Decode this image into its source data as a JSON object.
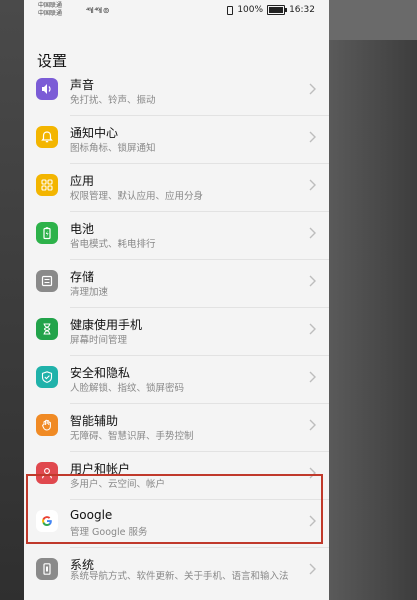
{
  "status": {
    "carrier1": "中国联通",
    "carrier2": "中国联通",
    "signal": "⁴⁶ıl ⁴⁶ıl ⊚",
    "battery_pct": "100%",
    "time": "16:32"
  },
  "page": {
    "title": "设置"
  },
  "items": [
    {
      "title": "声音",
      "sub": "免打扰、铃声、振动",
      "icon": "speaker-icon",
      "color": "#7b5cd6"
    },
    {
      "title": "通知中心",
      "sub": "图标角标、锁屏通知",
      "icon": "bell-icon",
      "color": "#f3b500"
    },
    {
      "title": "应用",
      "sub": "权限管理、默认应用、应用分身",
      "icon": "apps-grid-icon",
      "color": "#f3b500"
    },
    {
      "title": "电池",
      "sub": "省电模式、耗电排行",
      "icon": "battery-icon",
      "color": "#2db24a"
    },
    {
      "title": "存储",
      "sub": "清理加速",
      "icon": "storage-icon",
      "color": "#8a8a8a"
    },
    {
      "title": "健康使用手机",
      "sub": "屏幕时间管理",
      "icon": "hourglass-icon",
      "color": "#22a34a"
    },
    {
      "title": "安全和隐私",
      "sub": "人脸解锁、指纹、锁屏密码",
      "icon": "shield-icon",
      "color": "#20b2aa"
    },
    {
      "title": "智能辅助",
      "sub": "无障碍、智慧识屏、手势控制",
      "icon": "hand-icon",
      "color": "#f08a24"
    },
    {
      "title": "用户和帐户",
      "sub": "多用户、云空间、帐户",
      "icon": "user-icon",
      "color": "#e0484e"
    },
    {
      "title": "Google",
      "sub": "管理 Google 服务",
      "icon": "google-icon",
      "color": "#ffffff"
    },
    {
      "title": "系统",
      "sub": "系统导航方式、软件更新、关于手机、语言和输入法",
      "icon": "phone-icon",
      "color": "#8a8a8a"
    }
  ]
}
